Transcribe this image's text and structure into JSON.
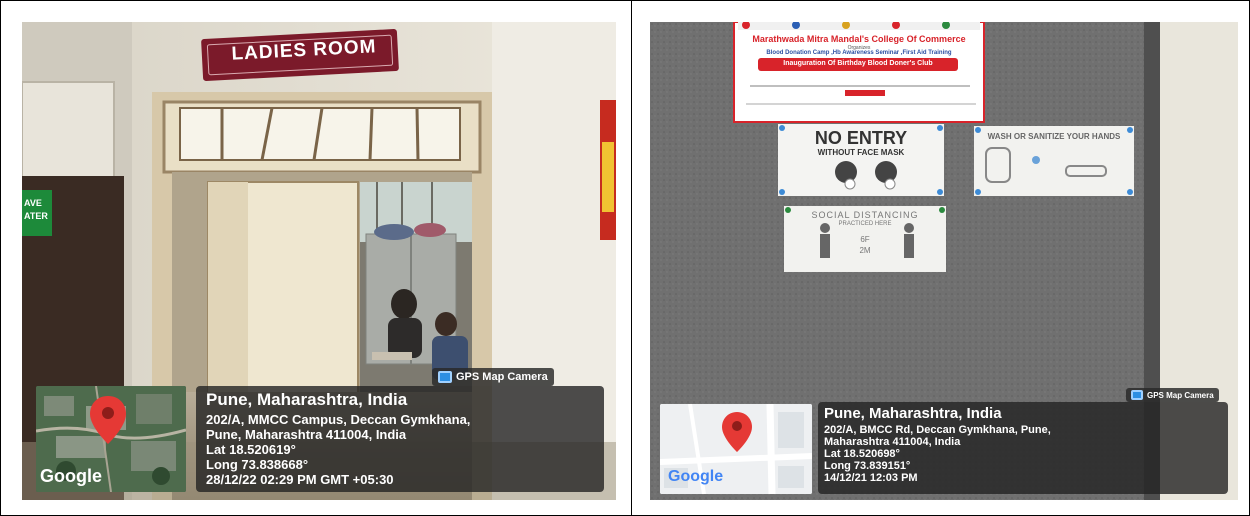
{
  "panels": [
    {
      "sign_text": "LADIES ROOM",
      "side_sign_text": "AVE\nATER",
      "gps_tag": "GPS Map Camera",
      "location_title": "Pune, Maharashtra, India",
      "address_lines": [
        "202/A, MMCC Campus, Deccan Gymkhana,",
        "Pune, Maharashtra 411004, India"
      ],
      "lat": "Lat 18.520619°",
      "long": "Long 73.838668°",
      "datetime": "28/12/22 02:29 PM GMT +05:30",
      "map_logo": "Google",
      "map_style": "satellite",
      "pin_color": "#e53935"
    },
    {
      "banner": {
        "org": "Marathwada Mitra Mandal's College Of Commerce",
        "organizes": "Organizes",
        "event": "Blood Donation Camp ,Hb Awareness Seminar ,First Aid Training",
        "highlight": "Inauguration Of Birthday Blood Doner's Club"
      },
      "posters": {
        "no_entry_title": "NO ENTRY",
        "no_entry_sub": "WITHOUT FACE MASK",
        "wash_title": "WASH OR SANITIZE YOUR HANDS",
        "distancing_title": "SOCIAL DISTANCING",
        "distancing_sub": "PRACTICED HERE",
        "distance_ft": "6F",
        "distance_m": "2M"
      },
      "gps_tag": "GPS Map Camera",
      "location_title": "Pune, Maharashtra, India",
      "address_lines": [
        "202/A, BMCC Rd, Deccan Gymkhana, Pune,",
        "Maharashtra 411004, India"
      ],
      "lat": "Lat 18.520698°",
      "long": "Long 73.839151°",
      "datetime": "14/12/21 12:03 PM",
      "map_logo": "Google",
      "map_style": "roadmap",
      "pin_color": "#e53935",
      "banner_red": "#d8232a"
    }
  ]
}
